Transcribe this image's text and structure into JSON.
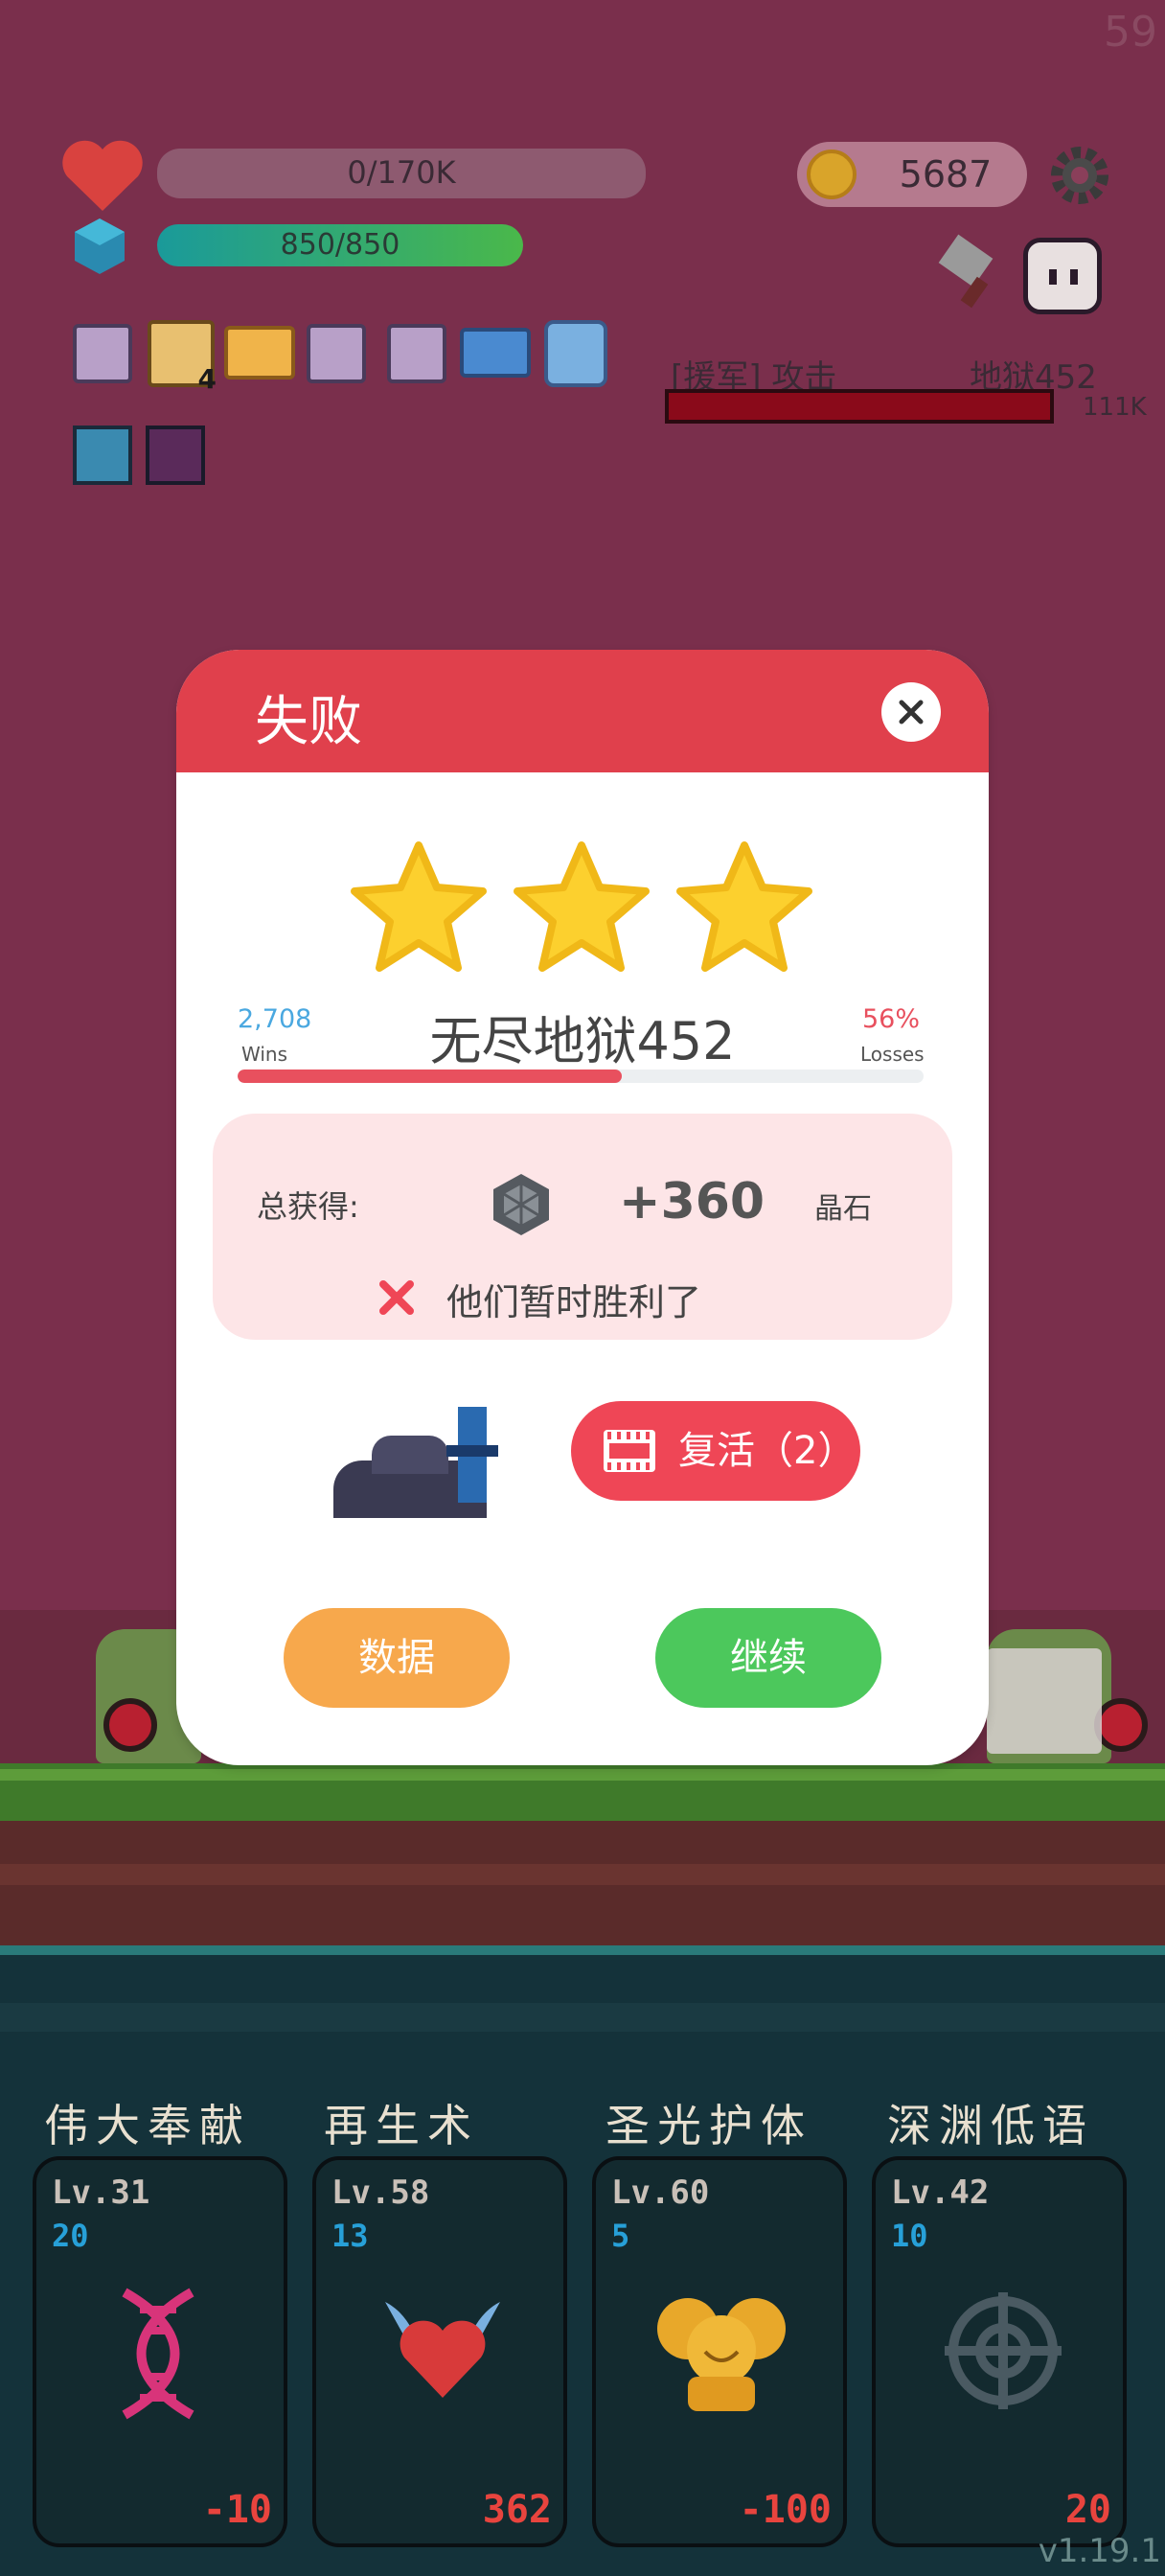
{
  "hud": {
    "hp_text": "0/170K",
    "mana_text": "850/850",
    "coins": "5687",
    "fps": "59",
    "enemy_action": "[援军] 攻击",
    "enemy_stage": "地狱452",
    "enemy_hp": "111K",
    "scroll_badge": "4"
  },
  "dialog": {
    "title": "失败",
    "stage_name": "无尽地狱452",
    "wins_value": "2,708",
    "wins_label": "Wins",
    "losses_value": "56%",
    "losses_label": "Losses",
    "win_fraction": 0.56,
    "reward_label": "总获得:",
    "reward_amount": "+360",
    "reward_unit": "晶石",
    "result_message": "他们暂时胜利了",
    "revive_label": "复活（2）",
    "stats_button": "数据",
    "continue_button": "继续"
  },
  "skills": [
    {
      "name": "伟大奉献",
      "level": "Lv.31",
      "count": "20",
      "cost": "-10",
      "icon": "dna-icon"
    },
    {
      "name": "再生术",
      "level": "Lv.58",
      "count": "13",
      "cost": "362",
      "icon": "winged-heart-icon"
    },
    {
      "name": "圣光护体",
      "level": "Lv.60",
      "count": "5",
      "cost": "-100",
      "icon": "golden-cherub-icon"
    },
    {
      "name": "深渊低语",
      "level": "Lv.42",
      "count": "10",
      "cost": "20",
      "icon": "crosshair-icon"
    }
  ],
  "version": "v1.19.1",
  "colors": {
    "overlay": "#7a2f4c",
    "header_red": "#e0404c",
    "progress_red": "#e8505e",
    "stats_orange": "#f7a84c",
    "continue_green": "#4cc85c",
    "revive_red": "#ef4656"
  }
}
